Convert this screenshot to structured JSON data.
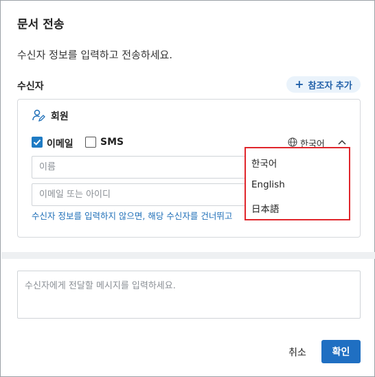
{
  "dialog": {
    "title": "문서 전송",
    "description": "수신자 정보를 입력하고 전송하세요."
  },
  "recipient": {
    "label": "수신자",
    "add_reference_label": "참조자 추가",
    "member_label": "회원",
    "channels": [
      {
        "label": "이메일",
        "checked": true
      },
      {
        "label": "SMS",
        "checked": false
      }
    ],
    "language": {
      "selected": "한국어",
      "options": [
        "한국어",
        "English",
        "日本語"
      ]
    },
    "name_placeholder": "이름",
    "email_placeholder": "이메일 또는 아이디",
    "hint": "수신자 정보를 입력하지 않으면, 해당 수신자를 건너뛰고"
  },
  "message": {
    "placeholder": "수신자에게 전달할 메시지를 입력하세요."
  },
  "footer": {
    "cancel_label": "취소",
    "confirm_label": "확인"
  },
  "colors": {
    "accent": "#1f6fc2",
    "highlight_border": "#e0252b"
  }
}
